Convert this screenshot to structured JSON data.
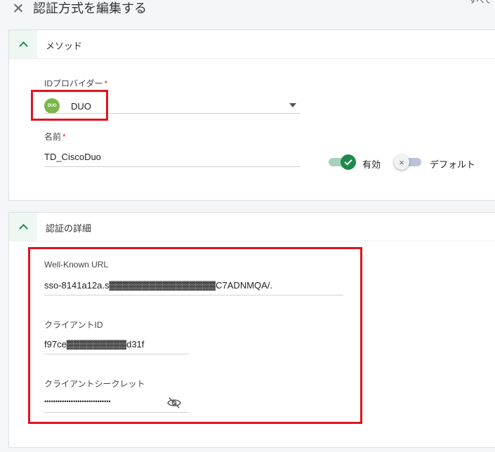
{
  "header": {
    "title": "認証方式を編集する",
    "corner_text": "すべて"
  },
  "method_section": {
    "title": "メソッド",
    "provider": {
      "label": "IDプロバイダー",
      "required_mark": "*",
      "logo_text": "DUO",
      "value": "DUO"
    },
    "name": {
      "label": "名前",
      "required_mark": "*",
      "value": "TD_CiscoDuo"
    },
    "enabled_toggle": {
      "label": "有効",
      "on": true
    },
    "default_toggle": {
      "label": "デフォルト",
      "on": false
    }
  },
  "details_section": {
    "title": "認証の詳細",
    "well_known_url": {
      "label": "Well-Known URL",
      "value": "sso-8141a12a.s▓▓▓▓▓▓▓▓▓▓▓▓▓▓▓▓C7ADNMQA/."
    },
    "client_id": {
      "label": "クライアントID",
      "value": "f97ce▓▓▓▓▓▓▓▓▓d31f"
    },
    "client_secret": {
      "label": "クライアントシークレット",
      "value": "••••••••••••••••••••••••••••••"
    }
  },
  "colors": {
    "accent_green": "#1f8a4c",
    "highlight_red": "#e0141e",
    "duo_green": "#7ab648"
  }
}
